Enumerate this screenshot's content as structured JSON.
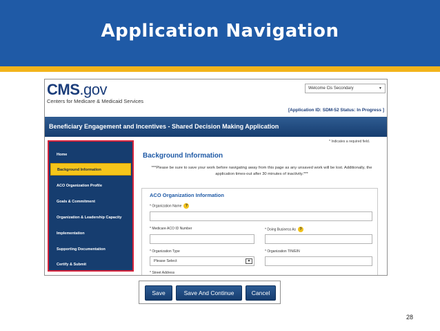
{
  "slide": {
    "title": "Application Navigation",
    "page_number": "28"
  },
  "brand": {
    "logo_main": "CMS",
    "logo_suffix": ".gov",
    "subtitle": "Centers for Medicare & Medicaid Services"
  },
  "header": {
    "welcome_select": "Welcome Cis Secondary",
    "application_status": "[Application ID: SDM-52    Status: In Progress ]"
  },
  "app_title": "Beneficiary Engagement and Incentives - Shared Decision Making Application",
  "sidebar": {
    "items": [
      {
        "label": "Home",
        "active": false
      },
      {
        "label": "Background Information",
        "active": true
      },
      {
        "label": "ACO Organization Profile",
        "active": false
      },
      {
        "label": "Goals & Commitment",
        "active": false
      },
      {
        "label": "Organization & Leadership Capacity",
        "active": false
      },
      {
        "label": "Implementation",
        "active": false
      },
      {
        "label": "Supporting Documentation",
        "active": false
      },
      {
        "label": "Certify & Submit",
        "active": false
      }
    ]
  },
  "main": {
    "required_note": "* Indicates a required field.",
    "section_title": "Background Information",
    "notice": "***Please be sure to save your work before navigating away from this page as any unsaved work will be lost. Additionally, the application times-out after 30 minutes of inactivity.***",
    "panel": {
      "title": "ACO Organization Information",
      "fields": {
        "organization_name": "* Organization Name",
        "aco_id": "* Medicare ACO ID Number",
        "doing_business_as": "* Doing Business As",
        "organization_type": "* Organization Type",
        "organization_tin": "* Organization TIN/EIN",
        "street_address": "* Street Address"
      },
      "organization_type_value": "Please Select"
    }
  },
  "buttons": {
    "save": "Save",
    "save_continue": "Save And Continue",
    "cancel": "Cancel"
  },
  "colors": {
    "header_blue": "#1f5aa6",
    "accent_gold": "#f2b41b",
    "nav_navy": "#163d6f",
    "sidebar_highlight": "#d6223a"
  }
}
